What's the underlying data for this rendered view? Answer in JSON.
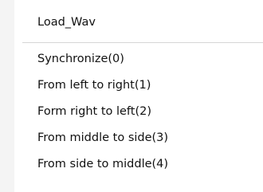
{
  "menu": {
    "header": "Load_Wav",
    "items": [
      {
        "label": "Synchronize(0)"
      },
      {
        "label": "From left to right(1)"
      },
      {
        "label": "Form right to left(2)"
      },
      {
        "label": "From middle to side(3)"
      },
      {
        "label": "From side to middle(4)"
      }
    ]
  }
}
